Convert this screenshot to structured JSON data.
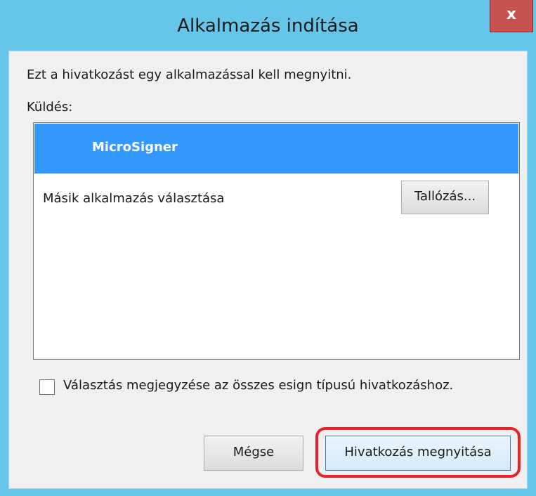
{
  "window": {
    "title": "Alkalmazás indítása",
    "close_label": "x"
  },
  "dialog": {
    "intro_text": "Ezt a hivatkozást egy alkalmazással kell megnyitni.",
    "send_label": "Küldés:",
    "apps": [
      {
        "label": "MicroSigner",
        "selected": true
      }
    ],
    "other_app_label": "Másik alkalmazás választása",
    "browse_button": "Tallózás...",
    "remember_checkbox": {
      "label": "Választás megjegyzése az összes esign típusú hivatkozáshoz.",
      "checked": false
    },
    "cancel_button": "Mégse",
    "open_button": "Hivatkozás megnyitása"
  },
  "colors": {
    "titlebar": "#66c6ea",
    "selection": "#3399ff",
    "close_button": "#c75050",
    "highlight_outline": "#e8202a"
  }
}
